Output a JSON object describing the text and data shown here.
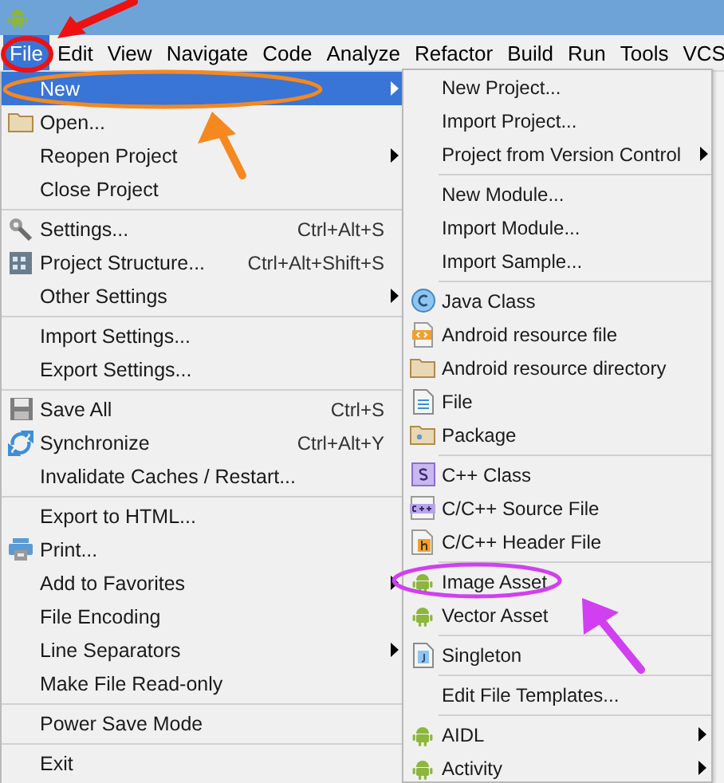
{
  "menubar": [
    {
      "label": "File",
      "selected": true
    },
    {
      "label": "Edit",
      "selected": false
    },
    {
      "label": "View",
      "selected": false
    },
    {
      "label": "Navigate",
      "selected": false
    },
    {
      "label": "Code",
      "selected": false
    },
    {
      "label": "Analyze",
      "selected": false
    },
    {
      "label": "Refactor",
      "selected": false
    },
    {
      "label": "Build",
      "selected": false
    },
    {
      "label": "Run",
      "selected": false
    },
    {
      "label": "Tools",
      "selected": false
    },
    {
      "label": "VCS",
      "selected": false
    }
  ],
  "file_menu": {
    "sections": [
      [
        {
          "label": "New",
          "selected": true,
          "submenu": true
        },
        {
          "label": "Open...",
          "selected": false,
          "submenu": false
        },
        {
          "label": "Reopen Project",
          "selected": false,
          "submenu": true
        },
        {
          "label": "Close Project",
          "selected": false,
          "submenu": false
        }
      ],
      [
        {
          "label": "Settings...",
          "shortcut": "Ctrl+Alt+S",
          "selected": false,
          "submenu": false
        },
        {
          "label": "Project Structure...",
          "shortcut": "Ctrl+Alt+Shift+S",
          "selected": false,
          "submenu": false
        },
        {
          "label": "Other Settings",
          "selected": false,
          "submenu": true
        }
      ],
      [
        {
          "label": "Import Settings...",
          "selected": false,
          "submenu": false
        },
        {
          "label": "Export Settings...",
          "selected": false,
          "submenu": false
        }
      ],
      [
        {
          "label": "Save All",
          "shortcut": "Ctrl+S",
          "selected": false,
          "submenu": false
        },
        {
          "label": "Synchronize",
          "shortcut": "Ctrl+Alt+Y",
          "selected": false,
          "submenu": false
        },
        {
          "label": "Invalidate Caches / Restart...",
          "selected": false,
          "submenu": false
        }
      ],
      [
        {
          "label": "Export to HTML...",
          "selected": false,
          "submenu": false
        },
        {
          "label": "Print...",
          "selected": false,
          "submenu": false
        },
        {
          "label": "Add to Favorites",
          "selected": false,
          "submenu": true
        },
        {
          "label": "File Encoding",
          "selected": false,
          "submenu": false
        },
        {
          "label": "Line Separators",
          "selected": false,
          "submenu": true
        },
        {
          "label": "Make File Read-only",
          "selected": false,
          "submenu": false
        }
      ],
      [
        {
          "label": "Power Save Mode",
          "selected": false,
          "submenu": false
        }
      ],
      [
        {
          "label": "Exit",
          "selected": false,
          "submenu": false
        }
      ]
    ]
  },
  "new_submenu": {
    "sections": [
      [
        {
          "label": "New Project...",
          "selected": false,
          "submenu": false
        },
        {
          "label": "Import Project...",
          "selected": false,
          "submenu": false
        },
        {
          "label": "Project from Version Control",
          "selected": false,
          "submenu": true
        }
      ],
      [
        {
          "label": "New Module...",
          "selected": false,
          "submenu": false
        },
        {
          "label": "Import Module...",
          "selected": false,
          "submenu": false
        },
        {
          "label": "Import Sample...",
          "selected": false,
          "submenu": false
        }
      ],
      [
        {
          "label": "Java Class",
          "selected": false,
          "submenu": false
        },
        {
          "label": "Android resource file",
          "selected": false,
          "submenu": false
        },
        {
          "label": "Android resource directory",
          "selected": false,
          "submenu": false
        },
        {
          "label": "File",
          "selected": false,
          "submenu": false
        },
        {
          "label": "Package",
          "selected": false,
          "submenu": false
        }
      ],
      [
        {
          "label": "C++ Class",
          "selected": false,
          "submenu": false
        },
        {
          "label": "C/C++ Source File",
          "selected": false,
          "submenu": false
        },
        {
          "label": "C/C++ Header File",
          "selected": false,
          "submenu": false
        }
      ],
      [
        {
          "label": "Image Asset",
          "selected": false,
          "submenu": false
        },
        {
          "label": "Vector Asset",
          "selected": false,
          "submenu": false
        }
      ],
      [
        {
          "label": "Singleton",
          "selected": false,
          "submenu": false
        }
      ],
      [
        {
          "label": "Edit File Templates...",
          "selected": false,
          "submenu": false
        }
      ],
      [
        {
          "label": "AIDL",
          "selected": false,
          "submenu": true
        },
        {
          "label": "Activity",
          "selected": false,
          "submenu": true
        }
      ]
    ]
  }
}
